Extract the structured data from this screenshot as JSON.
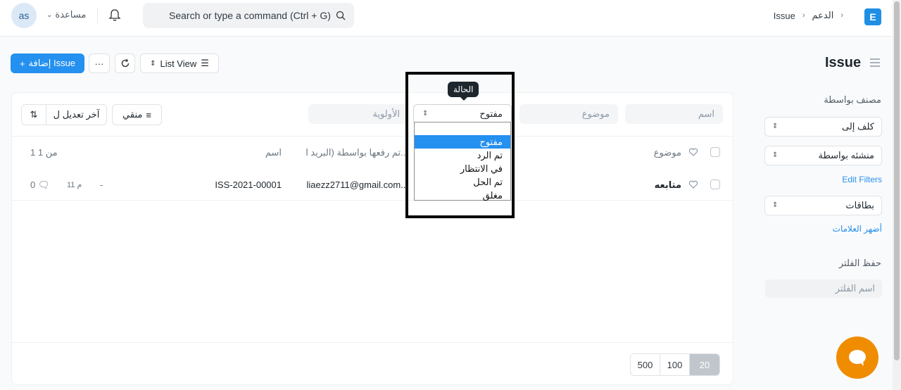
{
  "navbar": {
    "avatar": "as",
    "help": "مساعدة",
    "search_placeholder": "Search or type a command (Ctrl + G)",
    "breadcrumbs": [
      "Issue",
      "الدعم"
    ],
    "app_logo": "E"
  },
  "toolbar": {
    "add_label": "إضافة Issue",
    "more": "···",
    "view_label": "List View"
  },
  "page": {
    "title": "Issue"
  },
  "filters": {
    "name_placeholder": "اسم",
    "subject_placeholder": "موضوع",
    "status_value": "مفتوح",
    "priority_placeholder": "الأولوية",
    "status_tooltip": "الحالة",
    "filter_label": "منقي",
    "sort_label": "آخر تعديل ل"
  },
  "status_options": [
    "مفتوح",
    "تم الرد",
    "في الانتظار",
    "تم الحل",
    "مغلق"
  ],
  "list": {
    "header": {
      "subject": "موضوع",
      "raised_by": "تم رفعها بواسطة (البريد ا...",
      "name": "اسم",
      "count": "1 من 1"
    },
    "rows": [
      {
        "subject": "متابعه",
        "raised_by": "liaezz2711@gmail.com...",
        "name": "ISS-2021-00001",
        "dash": "-",
        "time": "11 م",
        "comments": "0"
      }
    ]
  },
  "pager": [
    "20",
    "100",
    "500"
  ],
  "sidebar": {
    "assigned_label": "مصنف بواسطة",
    "assigned_to": "كلف إلى",
    "created_by": "منشئه بواسطة",
    "edit_filters": "Edit Filters",
    "tags": "بطاقات",
    "show_tags": "أضهر العلامات",
    "save_filter": "حفظ الفلتر",
    "filter_name_placeholder": "اسم الفلتر"
  },
  "colors": {
    "primary": "#2490ef",
    "chat": "#f08c00"
  }
}
